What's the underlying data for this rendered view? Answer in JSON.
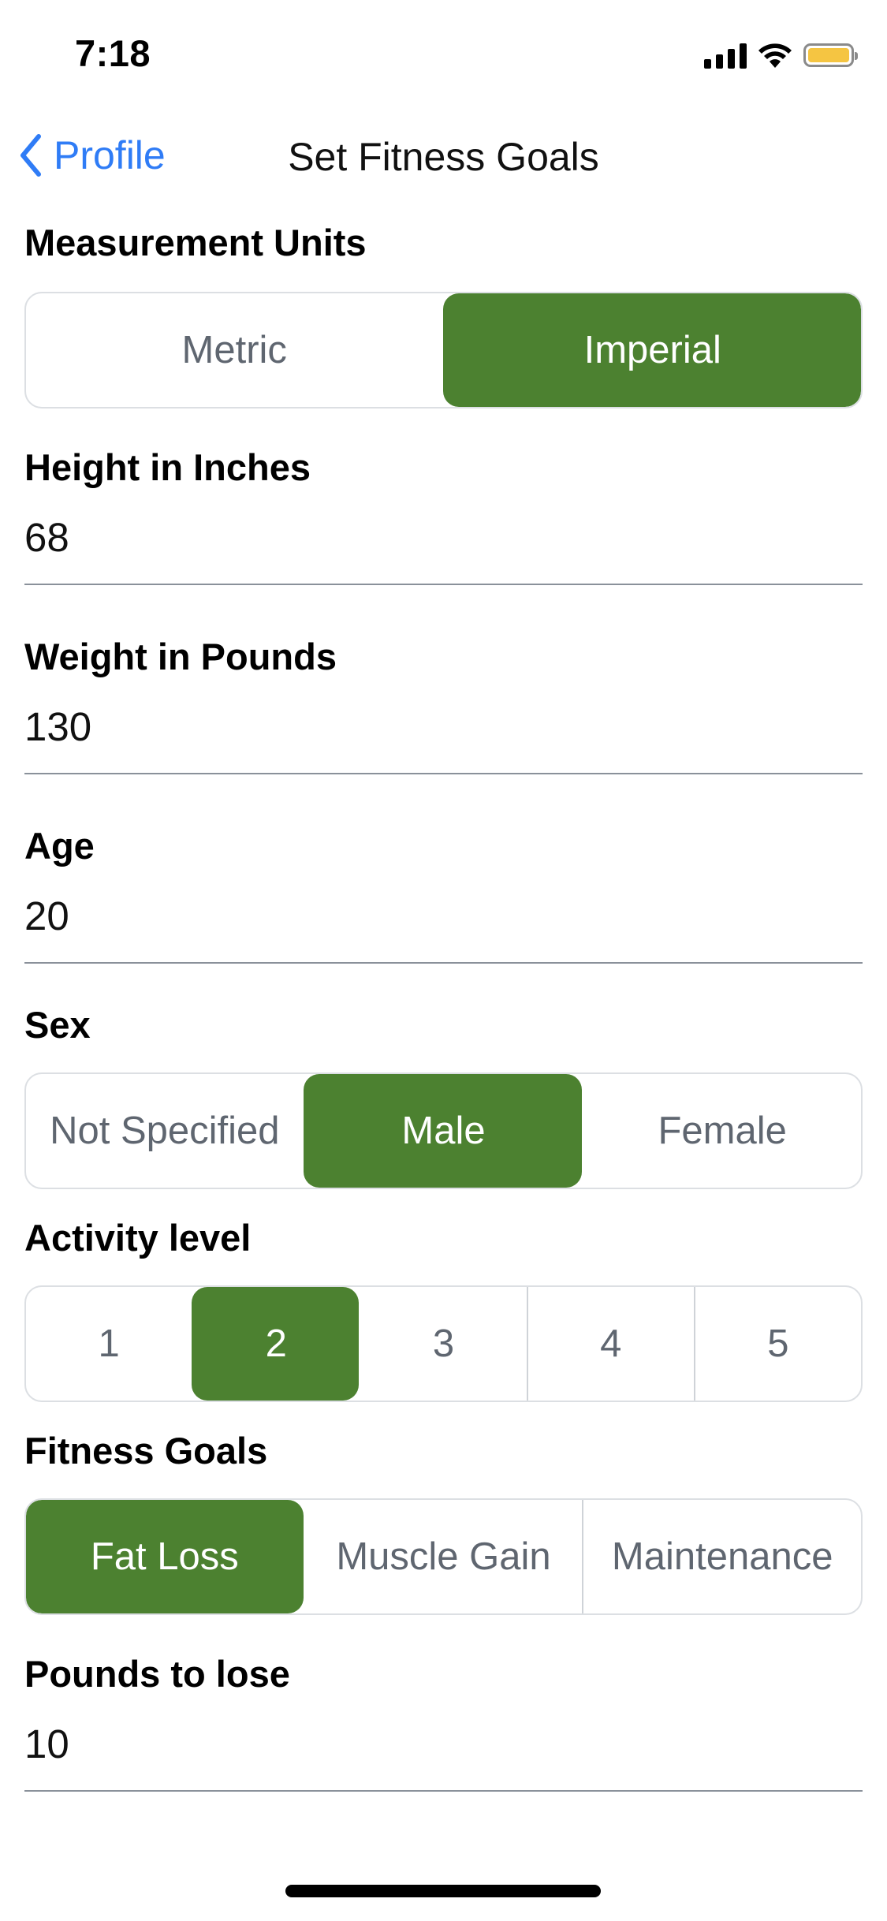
{
  "status_bar": {
    "time": "7:18",
    "battery_color": "#f5c542"
  },
  "nav": {
    "back_label": "Profile",
    "title": "Set Fitness Goals",
    "accent_color": "#2f7cf6"
  },
  "theme": {
    "selected_color": "#4c8130"
  },
  "measurement_units": {
    "label": "Measurement Units",
    "options": [
      "Metric",
      "Imperial"
    ],
    "selected": "Imperial"
  },
  "height": {
    "label": "Height in Inches",
    "value": "68"
  },
  "weight": {
    "label": "Weight in Pounds",
    "value": "130"
  },
  "age": {
    "label": "Age",
    "value": "20"
  },
  "sex": {
    "label": "Sex",
    "options": [
      "Not Specified",
      "Male",
      "Female"
    ],
    "selected": "Male"
  },
  "activity_level": {
    "label": "Activity level",
    "options": [
      "1",
      "2",
      "3",
      "4",
      "5"
    ],
    "selected": "2"
  },
  "fitness_goals": {
    "label": "Fitness Goals",
    "options": [
      "Fat Loss",
      "Muscle Gain",
      "Maintenance"
    ],
    "selected": "Fat Loss"
  },
  "pounds_to_lose": {
    "label": "Pounds to lose",
    "value": "10"
  }
}
